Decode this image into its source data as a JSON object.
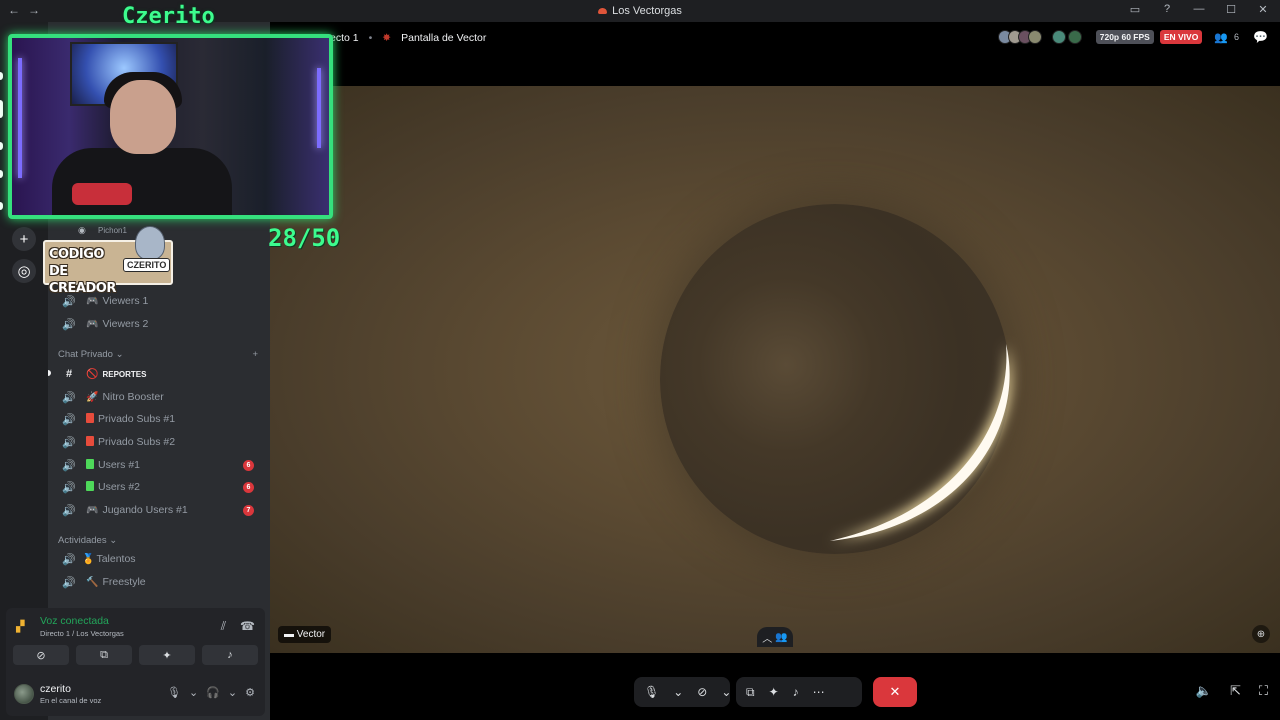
{
  "titlebar": {
    "back": "←",
    "forward": "→",
    "server_name": "Los Vectorgas",
    "controls": [
      "inbox-icon",
      "help-icon",
      "minimize-icon",
      "maximize-icon",
      "close-icon"
    ]
  },
  "stage": {
    "channel_partial": "ecto 1",
    "stream_name": "Pantalla de Vector",
    "quality": "720p 60 FPS",
    "live_label": "EN VIVO",
    "viewer_count": "6",
    "video_label": "Vector"
  },
  "sidebar": {
    "channels_top": [
      {
        "emoji": "🎮",
        "label": "Viewers 1"
      },
      {
        "emoji": "🎮",
        "label": "Viewers 2"
      }
    ],
    "category_private": "Chat Privado",
    "private_channels": [
      {
        "type": "text",
        "emoji": "🚫",
        "label": "REPORTES",
        "selected": true
      },
      {
        "type": "voice",
        "emoji": "🚀",
        "label": "Nitro Booster"
      },
      {
        "type": "voice",
        "color": "#e74c3c",
        "label": "Privado Subs #1"
      },
      {
        "type": "voice",
        "color": "#e74c3c",
        "label": "Privado Subs #2"
      },
      {
        "type": "voice",
        "color": "#4ed85a",
        "label": "Users #1",
        "badge": "6"
      },
      {
        "type": "voice",
        "color": "#4ed85a",
        "label": "Users #2",
        "badge": "6"
      },
      {
        "type": "voice",
        "emoji": "🎮",
        "label": "Jugando Users #1",
        "badge": "7"
      }
    ],
    "category_activities": "Actividades",
    "activity_channels": [
      {
        "emoji": "🏅",
        "label": "Talentos"
      },
      {
        "emoji": "🔨",
        "label": "Freestyle"
      }
    ],
    "pichon_label": "Pichon1"
  },
  "voice_panel": {
    "status": "Voz conectada",
    "location": "Directo 1 / Los Vectorgas"
  },
  "user": {
    "name": "czerito",
    "state": "En el canal de voz"
  },
  "overlay": {
    "cam_title": "Czerito",
    "counter": "28/50",
    "promo_line1": "CODIGO",
    "promo_line2": "DE CREADOR",
    "promo_sticker": "CZERITO"
  },
  "colors": {
    "accent_green": "#3dfc8e",
    "live_red": "#da373c",
    "connected_green": "#23a55a"
  }
}
